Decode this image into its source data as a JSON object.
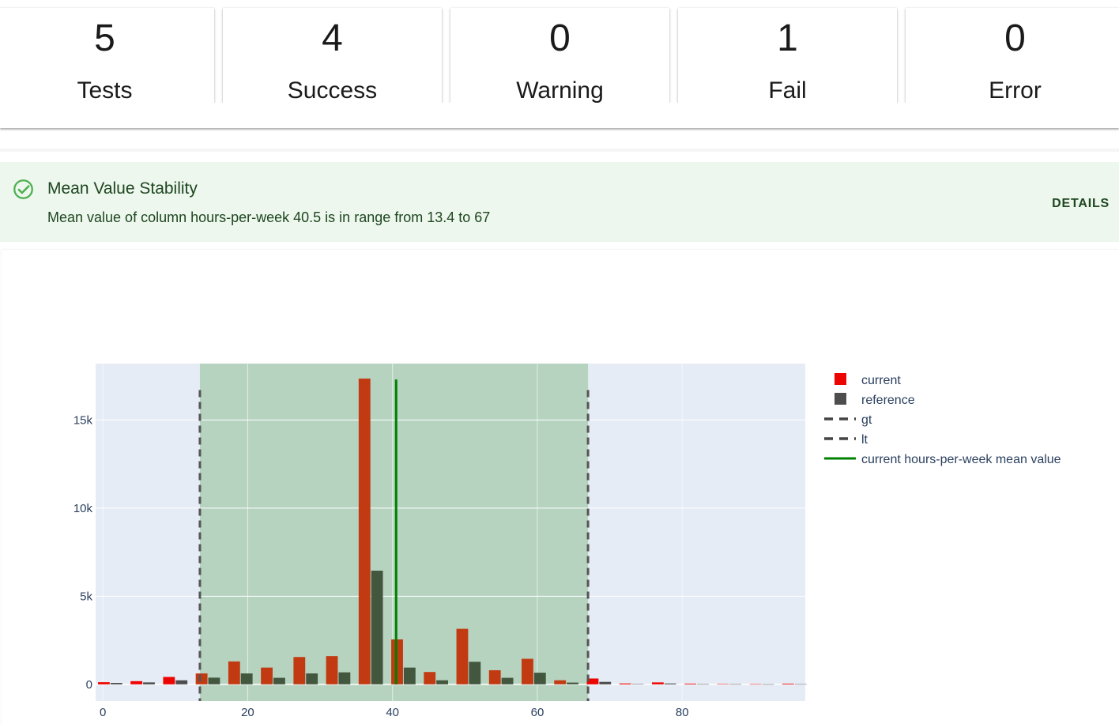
{
  "summary": [
    {
      "value": "5",
      "label": "Tests"
    },
    {
      "value": "4",
      "label": "Success"
    },
    {
      "value": "0",
      "label": "Warning"
    },
    {
      "value": "1",
      "label": "Fail"
    },
    {
      "value": "0",
      "label": "Error"
    }
  ],
  "test": {
    "title": "Mean Value Stability",
    "message": "Mean value of column hours-per-week 40.5 is in range from 13.4 to 67",
    "details_label": "DETAILS",
    "status_icon": "check-circle-icon",
    "status_color": "#4caf50"
  },
  "chart_data": {
    "type": "bar",
    "x_centers": [
      1,
      5.5,
      10,
      14.5,
      19,
      23.5,
      28,
      32.5,
      37,
      41.5,
      46,
      50.5,
      55,
      59.5,
      64,
      68.5,
      73,
      77.5,
      82,
      86.5,
      91,
      95.5
    ],
    "series": [
      {
        "name": "current",
        "color": "#ed0400",
        "values": [
          120,
          180,
          420,
          620,
          1300,
          950,
          1550,
          1600,
          17350,
          2550,
          700,
          3150,
          800,
          1450,
          230,
          330,
          50,
          110,
          40,
          20,
          10,
          40
        ]
      },
      {
        "name": "reference",
        "color": "#4d4d4d",
        "values": [
          80,
          110,
          230,
          380,
          620,
          370,
          620,
          680,
          6450,
          950,
          230,
          1280,
          370,
          660,
          100,
          140,
          20,
          50,
          10,
          10,
          5,
          10
        ]
      }
    ],
    "gt": {
      "name": "gt",
      "value": 13.4
    },
    "lt": {
      "name": "lt",
      "value": 67
    },
    "mean_line": {
      "name": "current hours-per-week mean value",
      "value": 40.5,
      "color": "#008000"
    },
    "shaded_range": [
      13.4,
      67
    ],
    "xlim": [
      -1,
      97
    ],
    "ylim": [
      -950,
      18200
    ],
    "x_ticks": [
      0,
      20,
      40,
      60,
      80
    ],
    "y_ticks": [
      0,
      5000,
      10000,
      15000
    ],
    "y_tick_labels": [
      "0",
      "5k",
      "10k",
      "15k"
    ],
    "legend_position": "top-right",
    "grid": true
  }
}
